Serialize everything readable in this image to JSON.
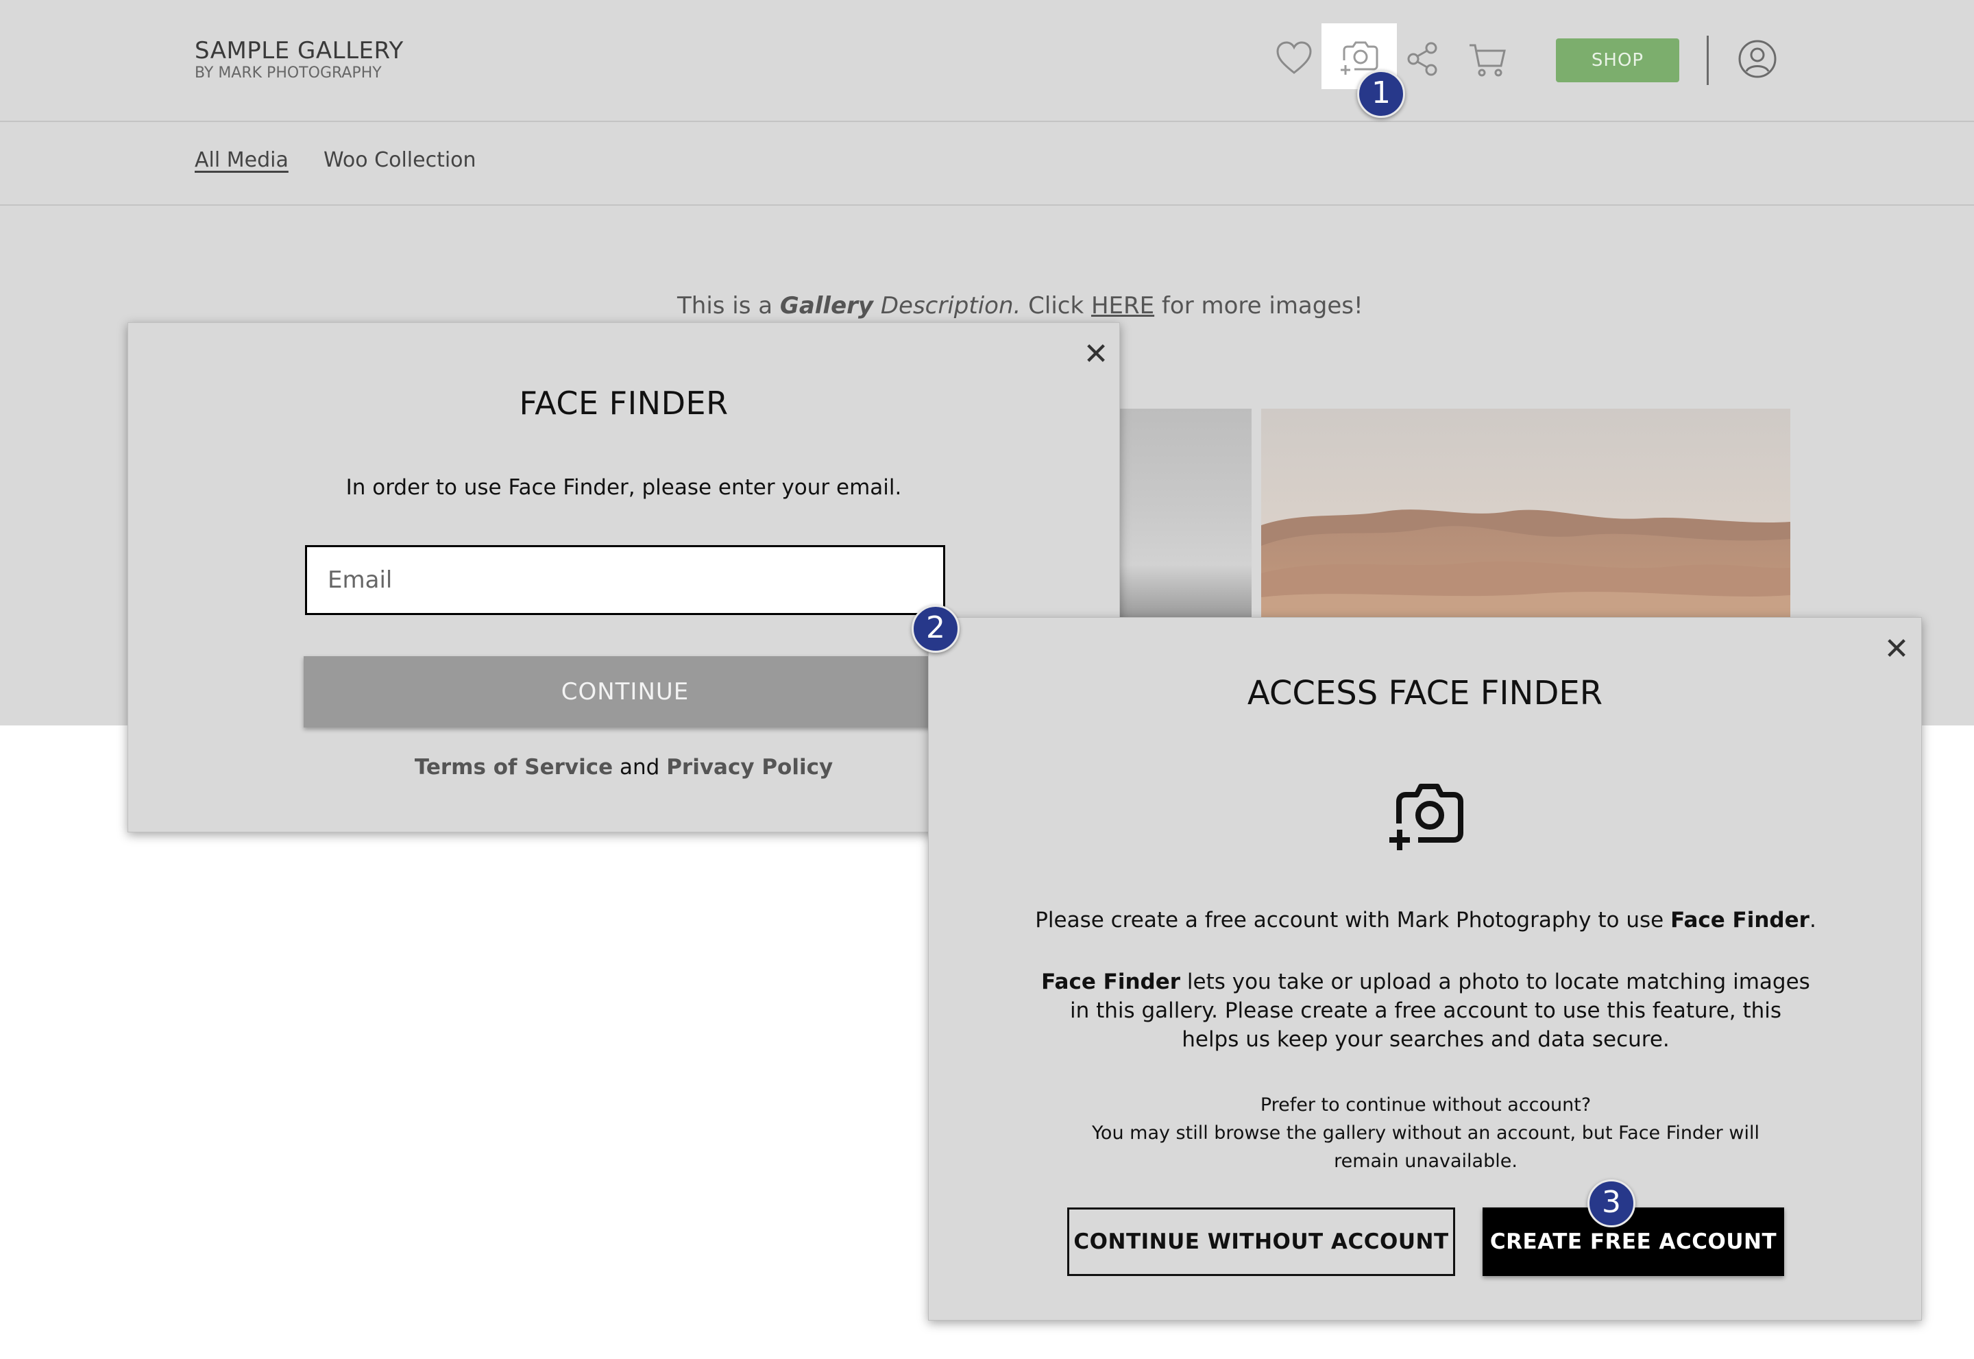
{
  "header": {
    "brand_title": "SAMPLE GALLERY",
    "brand_subtitle": "BY MARK PHOTOGRAPHY",
    "shop_label": "SHOP",
    "icons": [
      "heart-icon",
      "face-finder-camera-icon",
      "share-icon",
      "cart-icon",
      "user-account-icon"
    ]
  },
  "subnav": {
    "items": [
      {
        "label": "All Media",
        "active": true
      },
      {
        "label": "Woo Collection",
        "active": false
      }
    ]
  },
  "gallery": {
    "description": {
      "prefix": "This is a ",
      "bold_italic": "Gallery",
      "italic": " Description.",
      "middle": " Click ",
      "link": "HERE",
      "suffix": " for more images!"
    }
  },
  "face_finder_modal": {
    "title": "FACE FINDER",
    "instruction": "In order to use Face Finder, please enter your email.",
    "email_placeholder": "Email",
    "continue_label": "CONTINUE",
    "legal": {
      "terms": "Terms of Service",
      "and": " and ",
      "privacy": "Privacy Policy"
    },
    "close_symbol": "✕"
  },
  "access_modal": {
    "title": "ACCESS FACE FINDER",
    "p1_prefix": "Please create a free account with Mark Photography to use ",
    "p1_bold": "Face Finder",
    "p1_suffix": ".",
    "p2_bold": "Face Finder",
    "p2_text": " lets you take or upload a photo to locate matching images in this gallery. Please create a free account to use this feature, this helps us keep your searches and data secure.",
    "p3_line1": "Prefer to continue without account?",
    "p3_line2": "You may still browse the gallery without an account, but Face Finder will remain unavailable.",
    "continue_without_label": "CONTINUE WITHOUT ACCOUNT",
    "create_account_label": "CREATE FREE ACCOUNT",
    "close_symbol": "✕"
  },
  "steps": [
    "1",
    "2",
    "3"
  ],
  "colors": {
    "overlay_gray": "#d9d9d9",
    "shop_green": "#7cae6d",
    "step_marker": "#27388a",
    "continue_gray": "#9a9a9a",
    "primary_black": "#000000"
  }
}
